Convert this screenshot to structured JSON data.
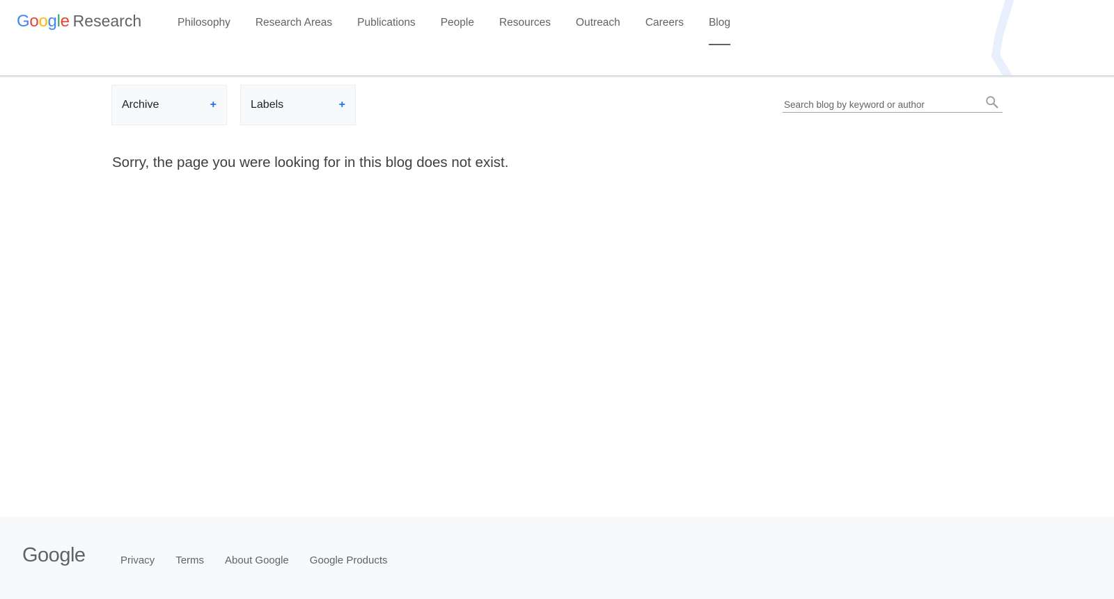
{
  "header": {
    "logo": {
      "letters": [
        {
          "char": "G",
          "color": "#4285F4"
        },
        {
          "char": "o",
          "color": "#EA4335"
        },
        {
          "char": "o",
          "color": "#FBBC05"
        },
        {
          "char": "g",
          "color": "#4285F4"
        },
        {
          "char": "l",
          "color": "#34A853"
        },
        {
          "char": "e",
          "color": "#EA4335"
        }
      ],
      "product": "Research"
    },
    "nav": [
      {
        "label": "Philosophy"
      },
      {
        "label": "Research Areas"
      },
      {
        "label": "Publications"
      },
      {
        "label": "People"
      },
      {
        "label": "Resources"
      },
      {
        "label": "Outreach"
      },
      {
        "label": "Careers"
      },
      {
        "label": "Blog",
        "active": true
      }
    ]
  },
  "filters": {
    "archive": {
      "label": "Archive",
      "icon": "plus-icon"
    },
    "labels": {
      "label": "Labels",
      "icon": "plus-icon"
    }
  },
  "search": {
    "placeholder": "Search blog by keyword or author",
    "value": "",
    "icon": "search-icon"
  },
  "main": {
    "message": "Sorry, the page you were looking for in this blog does not exist."
  },
  "footer": {
    "logo": "Google",
    "links": [
      "Privacy",
      "Terms",
      "About Google",
      "Google Products"
    ]
  },
  "colors": {
    "accent": "#1a73e8",
    "text": "#3c4043",
    "muted": "#5f6368",
    "footer_bg": "#f8f9fa"
  }
}
